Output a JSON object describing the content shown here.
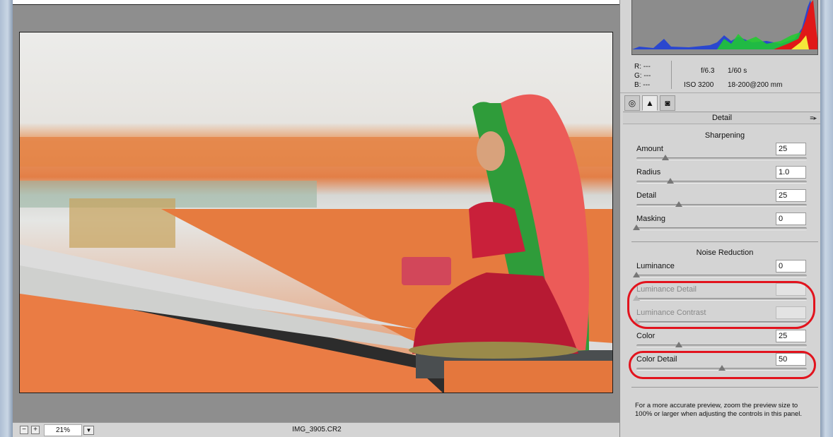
{
  "preview": {
    "zoom_value": "21%",
    "zoom_out_label": "−",
    "zoom_in_label": "+",
    "zoom_dropdown_icon": "chevron-down-icon",
    "filename": "IMG_3905.CR2"
  },
  "info": {
    "r_label": "R:",
    "r_value": "---",
    "g_label": "G:",
    "g_value": "---",
    "b_label": "B:",
    "b_value": "---",
    "aperture": "f/6.3",
    "shutter": "1/60 s",
    "iso": "ISO 3200",
    "lens": "18-200@200 mm"
  },
  "tabs": [
    "lens-aperture-icon",
    "detail-mountain-icon",
    "camera-calibration-icon"
  ],
  "panel": {
    "title": "Detail",
    "sharpening_title": "Sharpening",
    "noise_title": "Noise Reduction",
    "hint": "For a more accurate preview, zoom the preview size to 100% or larger when adjusting the controls in this panel."
  },
  "controls": {
    "amount": {
      "label": "Amount",
      "value": "25",
      "level": 0.17
    },
    "radius": {
      "label": "Radius",
      "value": "1.0",
      "level": 0.2
    },
    "detail": {
      "label": "Detail",
      "value": "25",
      "level": 0.25
    },
    "masking": {
      "label": "Masking",
      "value": "0",
      "level": 0.0
    },
    "luminance": {
      "label": "Luminance",
      "value": "0",
      "level": 0.0
    },
    "luminance_detail": {
      "label": "Luminance Detail",
      "value": "",
      "level": 0.0,
      "disabled": true
    },
    "luminance_contrast": {
      "label": "Luminance Contrast",
      "value": "",
      "level": 0.0,
      "disabled": true
    },
    "color": {
      "label": "Color",
      "value": "25",
      "level": 0.25
    },
    "color_detail": {
      "label": "Color Detail",
      "value": "50",
      "level": 0.5
    }
  },
  "colors": {
    "annotation": "#e2131d",
    "panel_bg": "#d4d4d4",
    "preview_bg": "#8e8e8e"
  }
}
